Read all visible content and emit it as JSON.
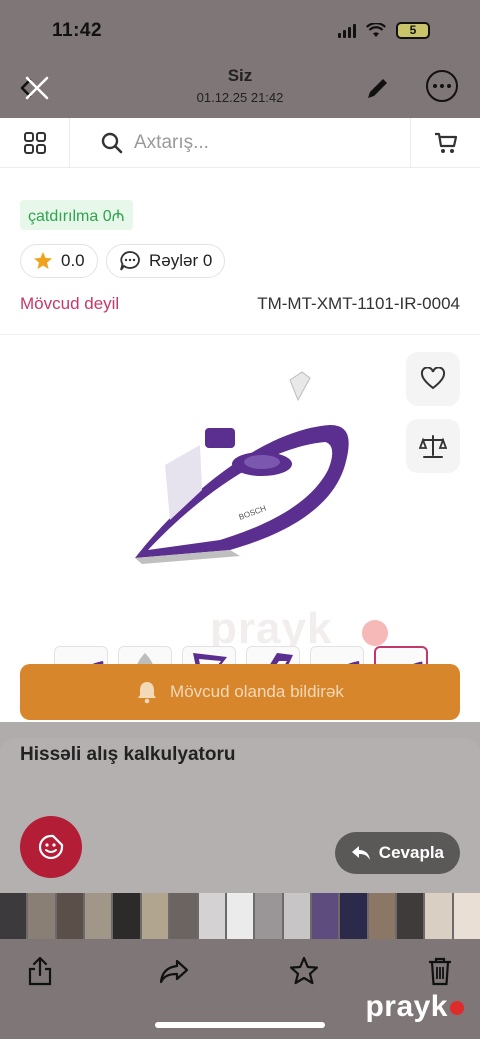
{
  "status_bar": {
    "time": "11:42",
    "battery": "5"
  },
  "viewer": {
    "sender": "Siz",
    "date": "01.12.25 21:42"
  },
  "search": {
    "placeholder": "Axtarış..."
  },
  "product": {
    "delivery": "çatdırılma 0₼",
    "rating": "0.0",
    "reviews_label": "Rəylər 0",
    "availability": "Mövcud deyil",
    "sku": "TM-MT-XMT-1101-IR-0004",
    "image_brand_text": "BOSCH",
    "watermark": "prayk"
  },
  "actions": {
    "notify_label": "Mövcud olanda bildirək",
    "calculator_title": "Hissəli alış kalkulyatoru",
    "reply_label": "Cevapla"
  },
  "brand": {
    "logo": "prayk"
  },
  "colors": {
    "accent": "#c3386a",
    "delivery_green": "#2fa44f",
    "notify_orange": "#d8862b",
    "iron_purple": "#5a2f8f"
  },
  "icons": [
    "close-icon",
    "pencil-icon",
    "more-icon",
    "grid-icon",
    "search-icon",
    "cart-icon",
    "star-icon",
    "chat-icon",
    "heart-icon",
    "scale-icon",
    "bell-icon",
    "sticker-icon",
    "reply-icon",
    "share-icon",
    "forward-icon",
    "star-outline-icon",
    "trash-icon"
  ]
}
